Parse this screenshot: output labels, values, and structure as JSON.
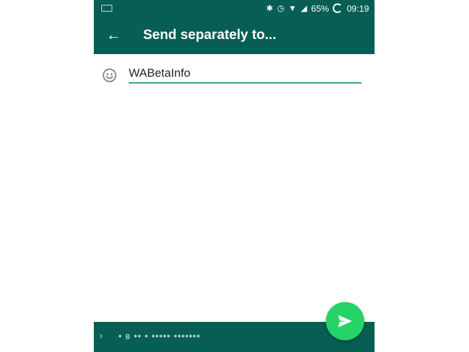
{
  "status_bar": {
    "battery": "65%",
    "time": "09:19",
    "icons": [
      "keyboard-icon",
      "bluetooth-icon",
      "alarm-icon",
      "wifi-icon",
      "signal-icon",
      "battery-icon"
    ]
  },
  "app_bar": {
    "back_icon": "arrow-left-icon",
    "title": "Send separately to..."
  },
  "name_field": {
    "value": "WABetaInfo",
    "icon": "emoji-icon"
  },
  "bottom_bar": {
    "chevron": "chevron-right-icon",
    "recipients_text": "• в •• • ••••• •••••••"
  },
  "send_button": {
    "icon": "send-icon",
    "color": "#25D366"
  },
  "colors": {
    "primary": "#075E54",
    "accent": "#25D366",
    "underline": "#2AA198"
  }
}
